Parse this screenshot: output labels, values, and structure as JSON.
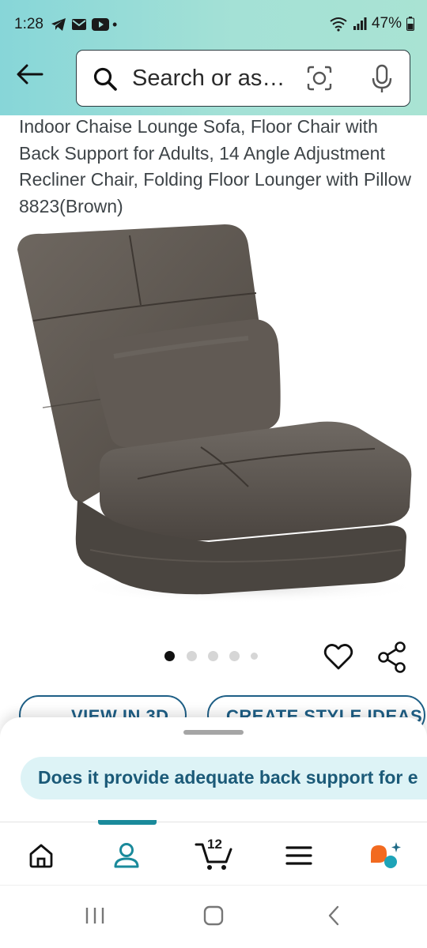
{
  "status_bar": {
    "time": "1:28",
    "battery": "47%",
    "notification_icons": [
      "telegram-icon",
      "mail-icon",
      "youtube-icon"
    ]
  },
  "search": {
    "placeholder": "Search or as…"
  },
  "product": {
    "title": "Indoor Chaise Lounge Sofa, Floor Chair with Back Support for Adults, 14 Angle Adjustment Recliner Chair, Folding Floor Lounger with Pillow 8823(Brown)",
    "image_count": 5,
    "active_image": 1
  },
  "actions": {
    "view_3d": "VIEW IN 3D",
    "create_style": "CREATE STYLE IDEAS"
  },
  "assistant": {
    "question": "Does it provide adequate back support for e"
  },
  "bottom_nav": {
    "items": [
      "home-icon",
      "account-icon",
      "cart-icon",
      "menu-icon",
      "rufus-icon"
    ],
    "cart_count": "12",
    "active": "account-icon"
  },
  "colors": {
    "header_start": "#87d6d8",
    "header_end": "#a9e3d3",
    "accent": "#1a8a9b",
    "link_blue": "#1e5f86",
    "assistant_bg": "#ddf3f6"
  }
}
